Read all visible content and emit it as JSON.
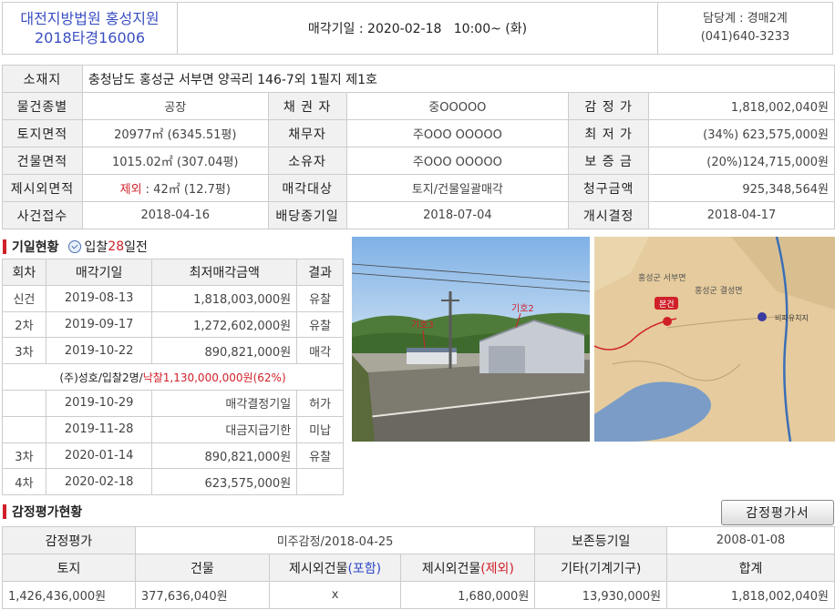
{
  "header": {
    "court_name": "대전지방법원 홍성지원",
    "case_number": "2018타경16006",
    "sale_date_text": "매각기일 : 2020-02-18   10:00~ (화)",
    "dept_name": "담당계 : 경매2계",
    "dept_phone": "(041)640-3233"
  },
  "info": {
    "address_label": "소재지",
    "address": "충청남도 홍성군 서부면 양곡리 146-7외 1필지 제1호",
    "type_label": "물건종별",
    "type": "공장",
    "creditor_label": "채 권 자",
    "creditor": "중OOOOO",
    "appraisal_label": "감 정 가",
    "appraisal": "1,818,002,040원",
    "land_label": "토지면적",
    "land": "20977㎡ (6345.51평)",
    "debtor_label": "채무자",
    "debtor": "주OOO OOOOO",
    "minprice_label": "최 저 가",
    "minprice": "(34%) 623,575,000원",
    "building_label": "건물면적",
    "building": "1015.02㎡ (307.04평)",
    "owner_label": "소유자",
    "owner": "주OOO OOOOO",
    "deposit_label": "보 증 금",
    "deposit": "(20%)124,715,000원",
    "excluded_label": "제시외면적",
    "excluded_prefix": "제외",
    "excluded": " : 42㎡ (12.7평)",
    "saletarget_label": "매각대상",
    "saletarget": "토지/건물일괄매각",
    "claim_label": "청구금액",
    "claim": "925,348,564원",
    "received_label": "사건접수",
    "received": "2018-04-16",
    "dividend_label": "배당종기일",
    "dividend": "2018-07-04",
    "start_label": "개시결정",
    "start": "2018-04-17"
  },
  "history": {
    "title": "기일현황",
    "bid_prefix": "입찰",
    "bid_days": "28",
    "bid_suffix": "일전",
    "headers": [
      "회차",
      "매각기일",
      "최저매각금액",
      "결과"
    ],
    "rows_a": [
      {
        "round": "신건",
        "date": "2019-08-13",
        "amount": "1,818,003,000원",
        "result": "유찰"
      },
      {
        "round": "2차",
        "date": "2019-09-17",
        "amount": "1,272,602,000원",
        "result": "유찰"
      },
      {
        "round": "3차",
        "date": "2019-10-22",
        "amount": "890,821,000원",
        "result": "매각"
      }
    ],
    "winner_prefix": "(주)성호/입찰2명/",
    "winner_amount": "낙찰1,130,000,000원(62%)",
    "rows_b": [
      {
        "round": "",
        "date": "2019-10-29",
        "amount": "매각결정기일",
        "result": "허가"
      },
      {
        "round": "",
        "date": "2019-11-28",
        "amount": "대금지급기한",
        "result": "미납"
      },
      {
        "round": "3차",
        "date": "2020-01-14",
        "amount": "890,821,000원",
        "result": "유찰"
      },
      {
        "round": "4차",
        "date": "2020-02-18",
        "amount": "623,575,000원",
        "result": ""
      }
    ]
  },
  "photo": {
    "label1": "기호3",
    "label2": "기호2"
  },
  "map": {
    "place1": "홍성군 서부면",
    "place2": "홍성군 결성면",
    "marker": "본건",
    "station": "비파유치지"
  },
  "appraisal": {
    "title": "감정평가현황",
    "button": "감정평가서",
    "row1_label": "감정평가",
    "row1_value": "미주감정/2018-04-25",
    "row1_label2": "보존등기일",
    "row1_value2": "2008-01-08",
    "headers": [
      "토지",
      "건물",
      "제시외건물",
      "(포함)",
      "제시외건물",
      "(제외)",
      "기타(기계기구)",
      "합계"
    ],
    "values": [
      "1,426,436,000원",
      "377,636,040원",
      "x",
      "1,680,000원",
      "13,930,000원",
      "1,818,002,040원"
    ]
  }
}
